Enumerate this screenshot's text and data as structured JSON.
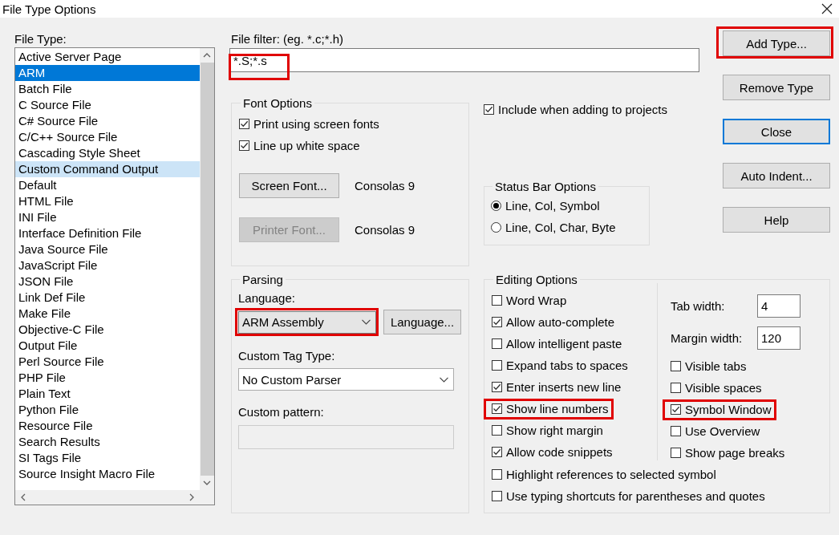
{
  "window": {
    "title": "File Type Options"
  },
  "file_type": {
    "label": "File Type:",
    "items": [
      {
        "label": "Active Server Page",
        "selected": false,
        "hot": false
      },
      {
        "label": "ARM",
        "selected": true,
        "hot": false
      },
      {
        "label": "Batch File",
        "selected": false,
        "hot": false
      },
      {
        "label": "C Source File",
        "selected": false,
        "hot": false
      },
      {
        "label": "C# Source File",
        "selected": false,
        "hot": false
      },
      {
        "label": "C/C++ Source File",
        "selected": false,
        "hot": false
      },
      {
        "label": "Cascading Style Sheet",
        "selected": false,
        "hot": false
      },
      {
        "label": "Custom Command Output",
        "selected": false,
        "hot": true
      },
      {
        "label": "Default",
        "selected": false,
        "hot": false
      },
      {
        "label": "HTML File",
        "selected": false,
        "hot": false
      },
      {
        "label": "INI File",
        "selected": false,
        "hot": false
      },
      {
        "label": "Interface Definition File",
        "selected": false,
        "hot": false
      },
      {
        "label": "Java Source File",
        "selected": false,
        "hot": false
      },
      {
        "label": "JavaScript File",
        "selected": false,
        "hot": false
      },
      {
        "label": "JSON File",
        "selected": false,
        "hot": false
      },
      {
        "label": "Link Def File",
        "selected": false,
        "hot": false
      },
      {
        "label": "Make File",
        "selected": false,
        "hot": false
      },
      {
        "label": "Objective-C File",
        "selected": false,
        "hot": false
      },
      {
        "label": "Output File",
        "selected": false,
        "hot": false
      },
      {
        "label": "Perl Source File",
        "selected": false,
        "hot": false
      },
      {
        "label": "PHP File",
        "selected": false,
        "hot": false
      },
      {
        "label": "Plain Text",
        "selected": false,
        "hot": false
      },
      {
        "label": "Python File",
        "selected": false,
        "hot": false
      },
      {
        "label": "Resource File",
        "selected": false,
        "hot": false
      },
      {
        "label": "Search Results",
        "selected": false,
        "hot": false
      },
      {
        "label": "SI Tags File",
        "selected": false,
        "hot": false
      },
      {
        "label": "Source Insight Macro File",
        "selected": false,
        "hot": false
      }
    ]
  },
  "file_filter": {
    "label": "File filter: (eg. *.c;*.h)",
    "value": "*.S;*.s",
    "annotated": true
  },
  "buttons": [
    {
      "label": "Add Type...",
      "default": false,
      "annotated": true
    },
    {
      "label": "Remove Type",
      "default": false,
      "annotated": false
    },
    {
      "label": "Close",
      "default": true,
      "annotated": false
    },
    {
      "label": "Auto Indent...",
      "default": false,
      "annotated": false
    },
    {
      "label": "Help",
      "default": false,
      "annotated": false
    }
  ],
  "font_options": {
    "title": "Font Options",
    "checkboxes": [
      {
        "label": "Print using screen fonts",
        "checked": true
      },
      {
        "label": "Line up white space",
        "checked": true
      }
    ],
    "fonts": [
      {
        "button": "Screen Font...",
        "disabled": false,
        "value": "Consolas 9"
      },
      {
        "button": "Printer Font...",
        "disabled": true,
        "value": "Consolas 9"
      }
    ]
  },
  "include": {
    "label": "Include when adding to projects",
    "checked": true
  },
  "status_bar": {
    "title": "Status Bar Options",
    "options": [
      {
        "label": "Line, Col, Symbol",
        "selected": true
      },
      {
        "label": "Line, Col, Char, Byte",
        "selected": false
      }
    ]
  },
  "parsing": {
    "title": "Parsing",
    "language_label": "Language:",
    "language": {
      "value": "ARM Assembly",
      "annotated": true
    },
    "language_button": "Language...",
    "tag_label": "Custom Tag Type:",
    "tag": {
      "value": "No Custom Parser"
    },
    "pattern_label": "Custom pattern:",
    "pattern": {
      "disabled": true
    }
  },
  "editing": {
    "title": "Editing Options",
    "left": [
      {
        "label": "Word Wrap",
        "checked": false,
        "annotated": false
      },
      {
        "label": "Allow auto-complete",
        "checked": true,
        "annotated": false
      },
      {
        "label": "Allow intelligent paste",
        "checked": false,
        "annotated": false
      },
      {
        "label": "Expand tabs to spaces",
        "checked": false,
        "annotated": false
      },
      {
        "label": "Enter inserts new line",
        "checked": true,
        "annotated": false
      },
      {
        "label": "Show line numbers",
        "checked": true,
        "annotated": true
      },
      {
        "label": "Show right margin",
        "checked": false,
        "annotated": false
      },
      {
        "label": "Allow code snippets",
        "checked": true,
        "annotated": false
      }
    ],
    "fields": [
      {
        "label": "Tab width:",
        "value": "4"
      },
      {
        "label": "Margin width:",
        "value": "120"
      }
    ],
    "right": [
      {
        "label": "Visible tabs",
        "checked": false,
        "annotated": false
      },
      {
        "label": "Visible spaces",
        "checked": false,
        "annotated": false
      },
      {
        "label": "Symbol Window",
        "checked": true,
        "annotated": true
      },
      {
        "label": "Use Overview",
        "checked": false,
        "annotated": false
      },
      {
        "label": "Show page breaks",
        "checked": false,
        "annotated": false
      }
    ],
    "bottom": [
      {
        "label": "Highlight references to selected symbol",
        "checked": false,
        "annotated": false
      },
      {
        "label": "Use typing shortcuts for parentheses and quotes",
        "checked": false,
        "annotated": false
      }
    ]
  }
}
